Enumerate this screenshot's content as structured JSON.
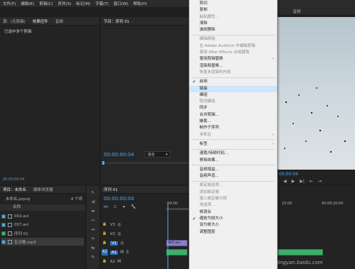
{
  "menubar": {
    "items": [
      "文件(F)",
      "编辑(E)",
      "剪辑(C)",
      "序列(S)",
      "标记(M)",
      "字幕(T)",
      "窗口(W)",
      "帮助(H)"
    ]
  },
  "left_panel": {
    "tabs": [
      "源：(无剪辑)",
      "效果控件",
      "音频"
    ],
    "message": "已选中多个剪辑",
    "timecode": "00:00:00:04"
  },
  "program": {
    "tab": "节目：序列 01",
    "timecode": "00:00:00:04",
    "fit_option": "适合",
    "right_tab": "音频",
    "right_timecode": "00:00:04",
    "tc_15": "15:00",
    "tc_20": "00:00:20:00"
  },
  "project": {
    "tabs": [
      "项目：未命名",
      "媒体浏览器"
    ],
    "name": "未命名.prproj",
    "count": "4 个项",
    "column": "名称",
    "items": [
      {
        "name": "002.avi",
        "color": "#5fa3d6"
      },
      {
        "name": "007.avi",
        "color": "#5fa3d6"
      },
      {
        "name": "序列 01",
        "color": "#44b56b"
      },
      {
        "name": "生日歌.mp3",
        "color": "#5fa3d6"
      }
    ]
  },
  "timeline": {
    "tab": "序列 01",
    "timecode": "00:00:00:04",
    "ruler_start": ":00:00",
    "tracks": [
      {
        "label": "V3"
      },
      {
        "label": "V2"
      },
      {
        "label": "V1",
        "clip": "007.avi"
      },
      {
        "label": "A1",
        "clip": ""
      },
      {
        "label": "A2"
      }
    ],
    "ruler_end": "00:00:20:00"
  },
  "context_menu": {
    "items": [
      {
        "label": "剪切",
        "type": "item"
      },
      {
        "label": "复制",
        "type": "item"
      },
      {
        "label": "粘贴属性...",
        "type": "disabled"
      },
      {
        "label": "清除",
        "type": "item"
      },
      {
        "label": "波纹删除",
        "type": "item"
      },
      {
        "type": "sep"
      },
      {
        "label": "编辑原始",
        "type": "disabled"
      },
      {
        "label": "在 Adobe Audition 中编辑剪辑",
        "type": "disabled"
      },
      {
        "label": "使用 After Effects 合成替换",
        "type": "disabled"
      },
      {
        "label": "使用剪辑替换",
        "type": "item",
        "sub": true
      },
      {
        "label": "渲染和替换...",
        "type": "item"
      },
      {
        "label": "恢复未渲染的内容",
        "type": "disabled"
      },
      {
        "type": "sep"
      },
      {
        "label": "启用",
        "type": "item",
        "check": true
      },
      {
        "label": "链接",
        "type": "item",
        "highlight": true
      },
      {
        "label": "编组",
        "type": "item"
      },
      {
        "label": "取消编组",
        "type": "disabled"
      },
      {
        "label": "同步",
        "type": "item"
      },
      {
        "label": "合并剪辑...",
        "type": "item"
      },
      {
        "label": "嵌套...",
        "type": "item"
      },
      {
        "label": "制作子序列",
        "type": "item"
      },
      {
        "label": "多机位",
        "type": "disabled",
        "sub": true
      },
      {
        "type": "sep"
      },
      {
        "label": "标签",
        "type": "item",
        "sub": true
      },
      {
        "type": "sep"
      },
      {
        "label": "速度/持续时间...",
        "type": "item"
      },
      {
        "label": "移除效果...",
        "type": "item"
      },
      {
        "type": "sep"
      },
      {
        "label": "音频增益...",
        "type": "item"
      },
      {
        "label": "音频声道...",
        "type": "item"
      },
      {
        "type": "sep"
      },
      {
        "label": "帧定格选项...",
        "type": "disabled"
      },
      {
        "label": "添加帧定格",
        "type": "disabled"
      },
      {
        "label": "插入帧定格分段",
        "type": "disabled"
      },
      {
        "label": "场选项...",
        "type": "disabled"
      },
      {
        "label": "帧混合",
        "type": "item"
      },
      {
        "label": "缩放为帧大小",
        "type": "item",
        "check": true
      },
      {
        "label": "设为帧大小",
        "type": "item"
      },
      {
        "label": "调整图层",
        "type": "item"
      }
    ]
  },
  "watermark": "jingyan.baidu.com"
}
